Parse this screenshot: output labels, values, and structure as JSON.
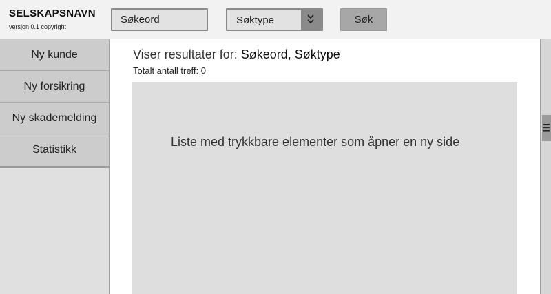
{
  "header": {
    "company_name": "SELSKAPSNAVN",
    "version_text": "versjon 0.1 copyright",
    "search_placeholder": "Søkeord",
    "search_type_value": "Søktype",
    "search_button_label": "Søk"
  },
  "sidebar": {
    "items": [
      {
        "label": "Ny kunde"
      },
      {
        "label": "Ny forsikring"
      },
      {
        "label": "Ny skademelding"
      },
      {
        "label": "Statistikk"
      }
    ]
  },
  "main": {
    "results_prefix": "Viser resultater for: ",
    "results_terms": "Søkeord, Søktype",
    "total_hits": "Totalt antall treff: 0",
    "list_placeholder": "Liste med trykkbare elementer som åpner en ny side"
  },
  "icons": {
    "dropdown": "chevron-double-icon",
    "scroll_grip": "grip-lines-icon"
  },
  "colors": {
    "header_bg": "#f2f2f2",
    "sidebar_item_bg": "#cccccc",
    "list_bg": "#dedede",
    "button_bg": "#a7a7a7"
  }
}
